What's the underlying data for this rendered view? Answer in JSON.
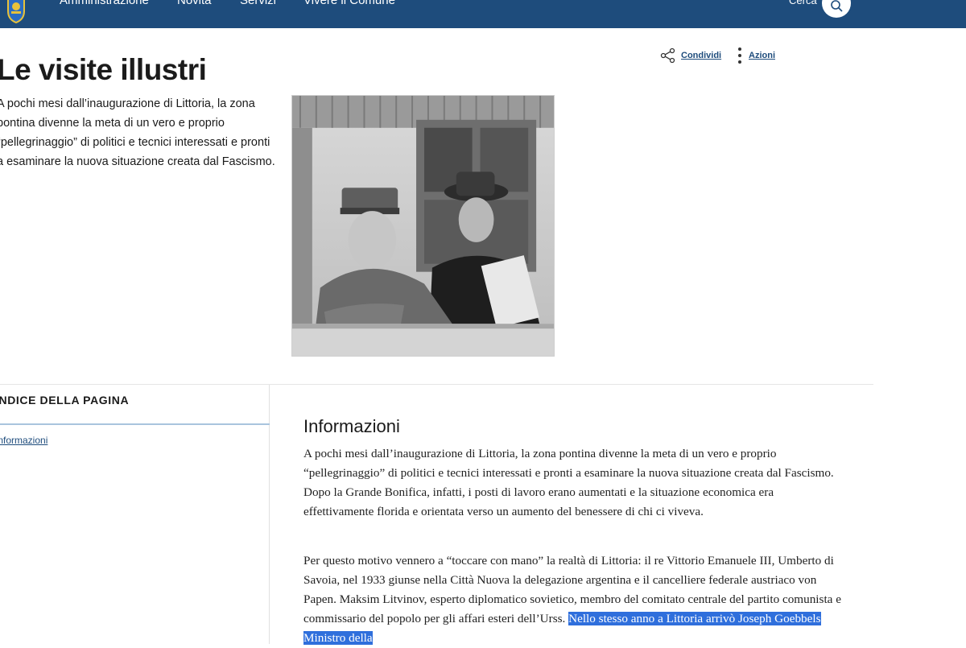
{
  "nav": {
    "items": [
      "Amministrazione",
      "Novità",
      "Servizi",
      "Vivere il Comune"
    ],
    "search_label": "Cerca"
  },
  "page": {
    "title": "Le visite illustri",
    "lead": "A pochi mesi dall’inaugurazione di Littoria, la zona pontina divenne la meta di un vero e proprio “pellegrinaggio” di politici e tecnici interessati e pronti a esaminare la nuova situazione creata dal Fascismo."
  },
  "actions": {
    "share_label": "Condividi",
    "more_label": "Azioni"
  },
  "index": {
    "title": "INDICE DELLA PAGINA",
    "links": [
      "Informazioni"
    ]
  },
  "article": {
    "section_title": "Informazioni",
    "paragraph1": "A pochi mesi dall’inaugurazione di Littoria, la zona pontina divenne la meta di un vero e proprio “pellegrinaggio” di politici e tecnici interessati e pronti a esaminare la nuova situazione creata dal Fascismo. Dopo la Grande Bonifica, infatti, i posti di lavoro erano aumentati e la situazione economica era effettivamente florida e orientata verso un aumento del benessere di chi ci viveva.",
    "paragraph2_start": "Per questo motivo vennero a “toccare con mano” la realtà di Littoria: il re Vittorio Emanuele III, Umberto di Savoia, nel 1933 giunse nella Città Nuova la delegazione argentina e il cancelliere federale austriaco von Papen. Maksim Litvinov, esperto diplomatico sovietico, membro del comitato centrale del partito comunista e commissario del popolo per gli affari esteri dell’Urss. ",
    "paragraph2_highlight": "Nello stesso anno a Littoria arrivò Joseph Goebbels Ministro della"
  },
  "colors": {
    "topbar": "#1e4c7c",
    "link": "#1e4c7c",
    "highlight": "#2f6fdc"
  },
  "icons": [
    "logo-emblem",
    "search-icon",
    "share-icon",
    "more-vertical-icon"
  ]
}
